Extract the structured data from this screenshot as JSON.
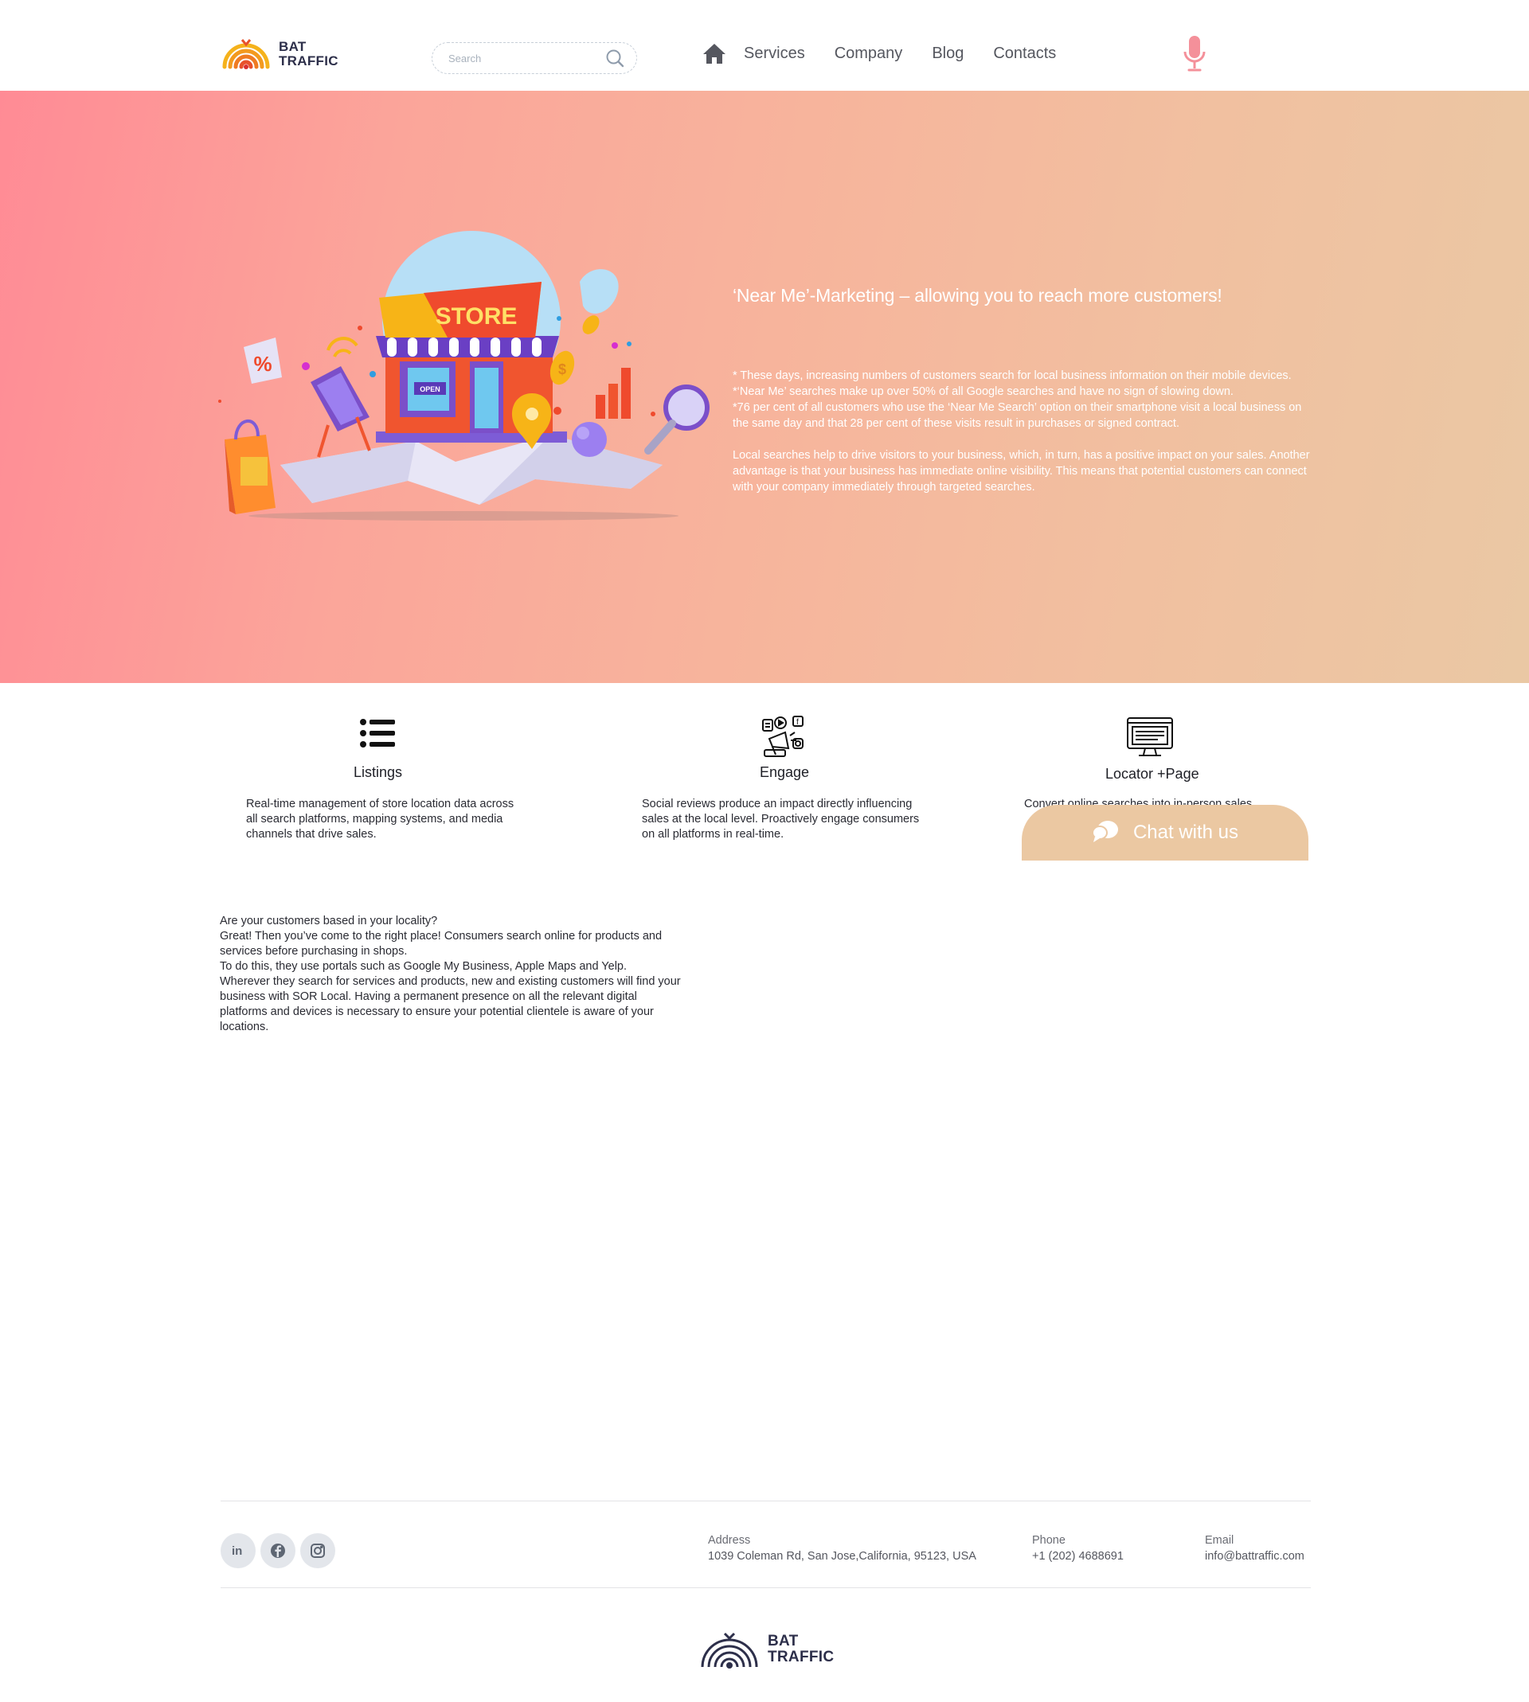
{
  "header": {
    "brand_line1": "BAT",
    "brand_line2": "TRAFFIC",
    "search_placeholder": "Search",
    "nav": [
      "Services",
      "Company",
      "Blog",
      "Contacts"
    ]
  },
  "hero": {
    "store_sign": "STORE",
    "open_sign": "OPEN",
    "title": "‘Near Me’-Marketing – allowing you to reach more customers!",
    "bullets": [
      "* These days, increasing numbers of customers search for local business information on their mobile devices.",
      "*‘Near Me’ searches make up over 50% of all Google searches and have no sign of slowing down.",
      "*76 per cent of all customers who use the ‘Near Me Search’ option on their smartphone visit a local business on the same day and that 28 per cent of these visits result in purchases or signed contract."
    ],
    "paragraph": "Local searches help to drive visitors to your business, which, in turn, has a positive impact on your sales. Another advantage is that your business has immediate online visibility. This means that potential customers can connect with your company immediately through targeted searches."
  },
  "features": [
    {
      "title": "Listings",
      "text": "Real-time management of store location data across all search platforms, mapping systems, and media channels that drive sales.",
      "icon": "list-icon"
    },
    {
      "title": "Engage",
      "text": "Social reviews produce an impact directly influencing sales at the local level. Proactively engage consumers on all platforms in real-time.",
      "icon": "social-megaphone-icon"
    },
    {
      "title": "Locator +Page",
      "text": "Convert online searches into in-person sales",
      "icon": "monitor-icon"
    }
  ],
  "chat": {
    "label": "Chat with us",
    "color": "#ebc8a2"
  },
  "body_copy": [
    "Are your customers based in your locality?",
    "Great! Then you’ve come to the right place! Consumers search online for products and services before purchasing in shops.",
    "To do this, they use portals such as Google My Business, Apple Maps and Yelp.",
    "Wherever they search for services and products, new and existing customers will find your business with SOR Local. Having a permanent presence on all the relevant digital platforms and devices is necessary to ensure your potential clientele is aware of your locations."
  ],
  "footer": {
    "social": [
      "linkedin-icon",
      "facebook-icon",
      "instagram-icon"
    ],
    "address_label": "Address",
    "address": "1039 Coleman Rd, San Jose,California,  95123, USA",
    "phone_label": "Phone",
    "phone": "+1 (202) 4688691",
    "email_label": "Email",
    "email": "info@battraffic.com",
    "social_labels": [
      "in",
      "f",
      ""
    ]
  },
  "colors": {
    "hero_start": "#ff8b95",
    "hero_end": "#eac8a4",
    "mic": "#f4909a",
    "chat": "#ebc8a2"
  }
}
